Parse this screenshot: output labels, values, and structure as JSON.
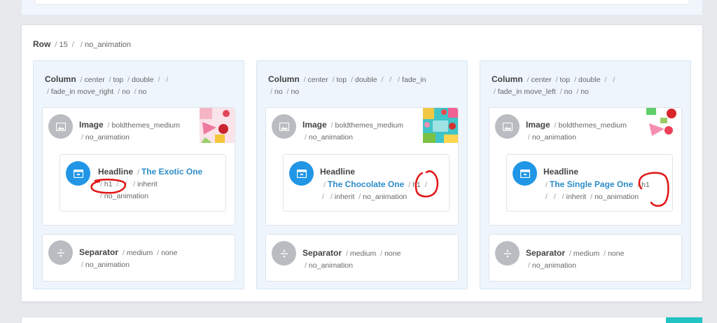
{
  "row": {
    "title": "Row",
    "params": [
      "15",
      "",
      "no_animation"
    ]
  },
  "columns": [
    {
      "title": "Column",
      "params": [
        "center",
        "top",
        "double",
        "",
        "",
        "fade_in move_right",
        "no",
        "no"
      ],
      "image": {
        "title": "Image",
        "size": "boldthemes_medium",
        "animation": "no_animation"
      },
      "headline": {
        "title": "Headline",
        "text": "The Exotic One",
        "params_line2": [
          "h1",
          "",
          "",
          "inherit"
        ],
        "params_line3": [
          "no_animation"
        ]
      },
      "separator": {
        "title": "Separator",
        "size": "medium",
        "border": "none",
        "animation": "no_animation"
      }
    },
    {
      "title": "Column",
      "params": [
        "center",
        "top",
        "double",
        "",
        "",
        "fade_in",
        "no",
        "no"
      ],
      "image": {
        "title": "Image",
        "size": "boldthemes_medium",
        "animation": "no_animation"
      },
      "headline": {
        "title": "Headline",
        "text": "The Chocolate One",
        "params_line2": [
          "h1",
          ""
        ],
        "params_line3": [
          "",
          "inherit",
          "no_animation"
        ]
      },
      "separator": {
        "title": "Separator",
        "size": "medium",
        "border": "none",
        "animation": "no_animation"
      }
    },
    {
      "title": "Column",
      "params": [
        "center",
        "top",
        "double",
        "",
        "",
        "fade_in move_left",
        "no",
        "no"
      ],
      "image": {
        "title": "Image",
        "size": "boldthemes_medium",
        "animation": "no_animation"
      },
      "headline": {
        "title": "Headline",
        "text": "The Single Page One",
        "params_line2": [
          "h1"
        ],
        "params_line3": [
          "",
          "",
          "inherit",
          "no_animation"
        ]
      },
      "separator": {
        "title": "Separator",
        "size": "medium",
        "border": "none",
        "animation": "no_animation"
      }
    }
  ],
  "icons": {
    "image": "image-icon",
    "headline": "headline-icon",
    "separator": "divide-icon"
  },
  "colors": {
    "accent_blue": "#2196e6",
    "link": "#2d8cc8",
    "annotation_red": "#e01414",
    "column_bg": "#eef5fc"
  }
}
